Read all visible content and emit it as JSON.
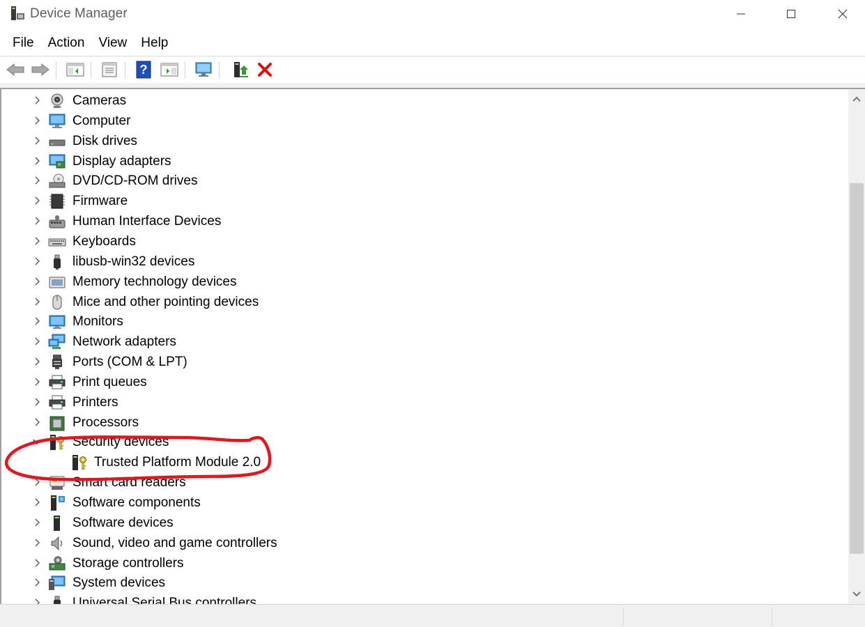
{
  "window": {
    "title": "Device Manager",
    "controls": [
      "minimize",
      "maximize",
      "close"
    ]
  },
  "menu": [
    "File",
    "Action",
    "View",
    "Help"
  ],
  "toolbar": {
    "buttons": [
      "back-icon",
      "forward-icon",
      "show-hide-console-tree-icon",
      "properties-icon",
      "help-icon",
      "action-pane-icon",
      "scan-hardware-icon",
      "update-driver-icon",
      "uninstall-device-icon"
    ]
  },
  "tree": {
    "items": [
      {
        "label": "Cameras",
        "icon": "camera-icon",
        "expanded": false
      },
      {
        "label": "Computer",
        "icon": "computer-icon",
        "expanded": false
      },
      {
        "label": "Disk drives",
        "icon": "disk-drive-icon",
        "expanded": false
      },
      {
        "label": "Display adapters",
        "icon": "display-adapter-icon",
        "expanded": false
      },
      {
        "label": "DVD/CD-ROM drives",
        "icon": "dvd-drive-icon",
        "expanded": false
      },
      {
        "label": "Firmware",
        "icon": "firmware-icon",
        "expanded": false
      },
      {
        "label": "Human Interface Devices",
        "icon": "hid-icon",
        "expanded": false
      },
      {
        "label": "Keyboards",
        "icon": "keyboard-icon",
        "expanded": false
      },
      {
        "label": "libusb-win32 devices",
        "icon": "usb-plug-icon",
        "expanded": false
      },
      {
        "label": "Memory technology devices",
        "icon": "memory-device-icon",
        "expanded": false
      },
      {
        "label": "Mice and other pointing devices",
        "icon": "mouse-icon",
        "expanded": false
      },
      {
        "label": "Monitors",
        "icon": "monitor-icon",
        "expanded": false
      },
      {
        "label": "Network adapters",
        "icon": "network-adapter-icon",
        "expanded": false
      },
      {
        "label": "Ports (COM & LPT)",
        "icon": "port-icon",
        "expanded": false
      },
      {
        "label": "Print queues",
        "icon": "printer-icon",
        "expanded": false
      },
      {
        "label": "Printers",
        "icon": "printer-icon",
        "expanded": false
      },
      {
        "label": "Processors",
        "icon": "processor-icon",
        "expanded": false
      },
      {
        "label": "Security devices",
        "icon": "security-key-icon",
        "expanded": true
      },
      {
        "label": "Trusted Platform Module 2.0",
        "icon": "security-key-icon",
        "child": true
      },
      {
        "label": "Smart card readers",
        "icon": "smart-card-icon",
        "expanded": false
      },
      {
        "label": "Software components",
        "icon": "software-component-icon",
        "expanded": false
      },
      {
        "label": "Software devices",
        "icon": "software-device-icon",
        "expanded": false
      },
      {
        "label": "Sound, video and game controllers",
        "icon": "speaker-icon",
        "expanded": false
      },
      {
        "label": "Storage controllers",
        "icon": "storage-controller-icon",
        "expanded": false
      },
      {
        "label": "System devices",
        "icon": "system-device-icon",
        "expanded": false
      },
      {
        "label": "Universal Serial Bus controllers",
        "icon": "usb-plug-icon",
        "expanded": false
      }
    ]
  },
  "colors": {
    "annotation": "#e8141c",
    "uninstall": "#e01010",
    "help_blue": "#1d4fb5"
  }
}
